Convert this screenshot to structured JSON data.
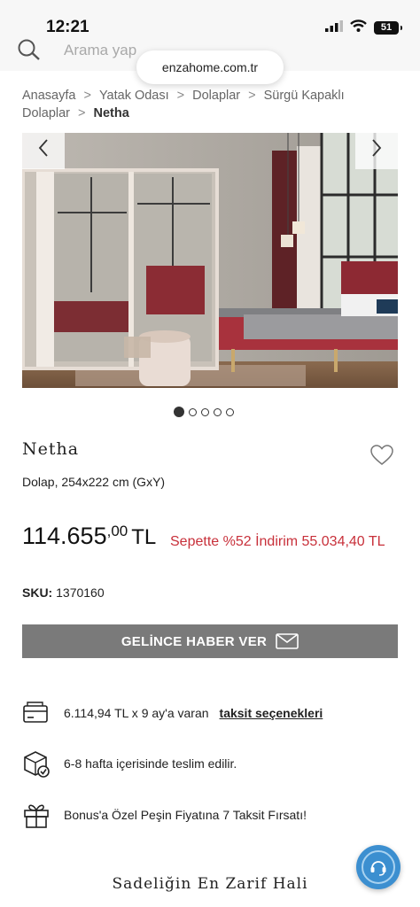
{
  "status_bar": {
    "time": "12:21",
    "battery": "51"
  },
  "search": {
    "placeholder": "Arama yap"
  },
  "browser": {
    "url": "enzahome.com.tr"
  },
  "breadcrumb": {
    "items": [
      "Anasayfa",
      "Yatak Odası",
      "Dolaplar",
      "Sürgü Kapaklı Dolaplar"
    ],
    "current": "Netha"
  },
  "gallery": {
    "image_count": 5,
    "active_index": 0
  },
  "product": {
    "name": "Netha",
    "description": "Dolap, 254x222 cm (GxY)",
    "price_integer": "114.655",
    "price_decimal": ",00",
    "currency": "TL",
    "promo_text": "Sepette %52 İndirim 55.034,40 TL",
    "sku_label": "SKU:",
    "sku_value": "1370160"
  },
  "notify_button": {
    "label": "GELİNCE HABER VER"
  },
  "info": {
    "installment_text": "6.114,94 TL x 9 ay'a varan",
    "installment_link": "taksit seçenekleri",
    "delivery_text": "6-8 hafta içerisinde teslim edilir.",
    "bonus_text": "Bonus'a Özel Peşin Fiyatına 7 Taksit Fırsatı!"
  },
  "footer": {
    "tagline": "Sadeliğin En Zarif Hali"
  },
  "colors": {
    "promo": "#c8303a",
    "button": "#7a7a7a",
    "support": "#3c8fd0",
    "bed": "#a8323d"
  },
  "icons": [
    "search-icon",
    "signal-icon",
    "wifi-icon",
    "battery-icon",
    "chevron-left-icon",
    "chevron-right-icon",
    "heart-icon",
    "mail-icon",
    "credit-card-icon",
    "delivery-box-icon",
    "gift-icon",
    "headset-icon"
  ]
}
